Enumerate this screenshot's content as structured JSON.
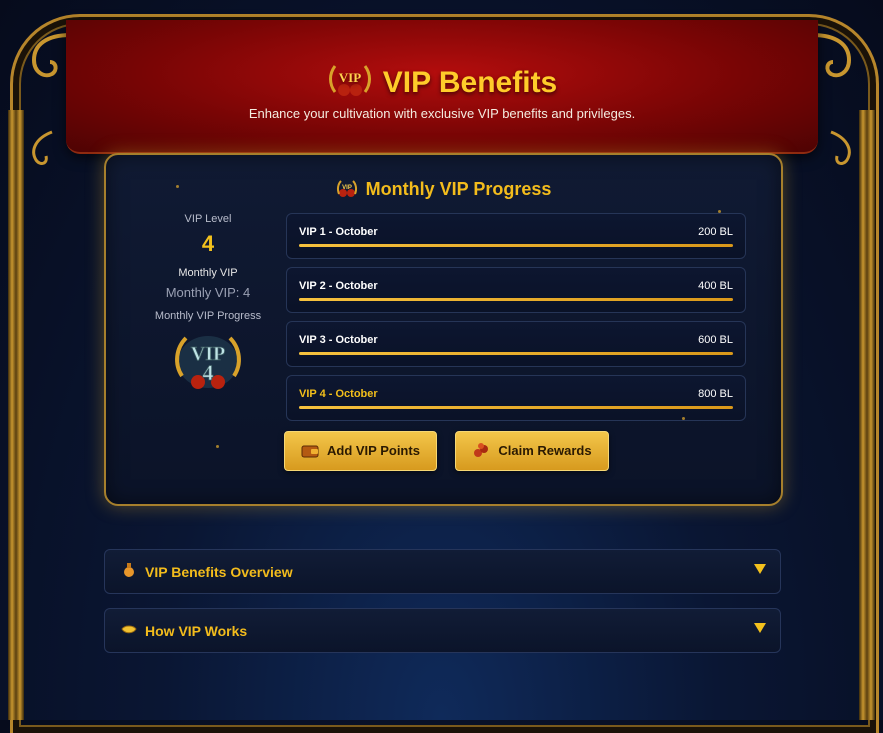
{
  "header": {
    "title": "VIP Benefits",
    "subtitle": "Enhance your cultivation with exclusive VIP benefits and privileges."
  },
  "progress_card": {
    "title": "Monthly VIP Progress",
    "vip_level_label": "VIP Level",
    "vip_level_value": "4",
    "monthly_vip_label": "Monthly VIP",
    "monthly_vip_value": "Monthly VIP: 4",
    "monthly_progress_label": "Monthly VIP Progress",
    "badge_text": "VIP",
    "badge_number": "4",
    "tiers": [
      {
        "name": "VIP 1 - October",
        "cost": "200 BL",
        "progress": 1.0
      },
      {
        "name": "VIP 2 - October",
        "cost": "400 BL",
        "progress": 1.0
      },
      {
        "name": "VIP 3 - October",
        "cost": "600 BL",
        "progress": 1.0
      },
      {
        "name": "VIP 4 - October",
        "cost": "800 BL",
        "progress": 1.0
      }
    ],
    "add_points_label": "Add VIP Points",
    "claim_rewards_label": "Claim Rewards"
  },
  "accordions": {
    "overview_label": "VIP Benefits Overview",
    "how_label": "How VIP Works"
  },
  "colors": {
    "gold": "#f3bc1c",
    "header_red": "#9e0a0a",
    "panel_navy": "#0b1328"
  },
  "icons": {
    "header": "vip-laurel-icon",
    "card_title": "vip-emblem-icon",
    "add_points": "wallet-icon",
    "claim_rewards": "treasure-icon",
    "overview": "potion-icon",
    "how": "ingot-icon",
    "chevrons": "chevron-down-icon"
  }
}
